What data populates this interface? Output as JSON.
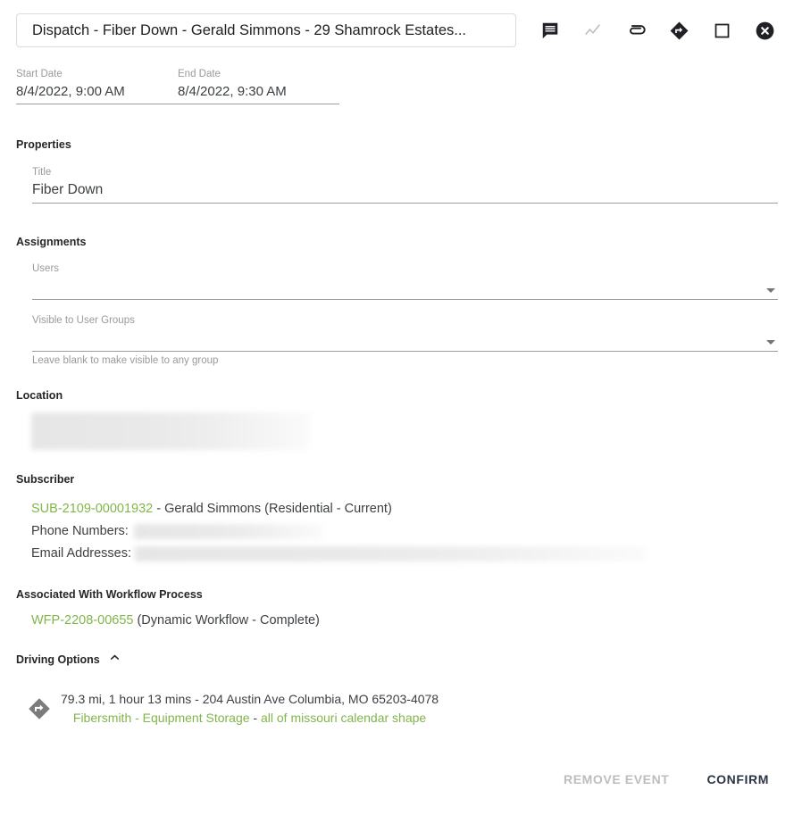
{
  "header": {
    "event_title": "Dispatch - Fiber Down - Gerald Simmons - 29 Shamrock Estates...",
    "actions": [
      {
        "name": "comments-icon",
        "label": "Comments"
      },
      {
        "name": "activity-icon",
        "label": "Activity"
      },
      {
        "name": "attachment-icon",
        "label": "Attachments"
      },
      {
        "name": "directions-icon",
        "label": "Directions"
      },
      {
        "name": "maximize-icon",
        "label": "Maximize"
      },
      {
        "name": "close-icon",
        "label": "Close"
      }
    ]
  },
  "dates": {
    "start_label": "Start Date",
    "start_value": "8/4/2022, 9:00 AM",
    "end_label": "End Date",
    "end_value": "8/4/2022, 9:30 AM"
  },
  "properties": {
    "heading": "Properties",
    "title_label": "Title",
    "title_value": "Fiber Down"
  },
  "assignments": {
    "heading": "Assignments",
    "users_label": "Users",
    "users_value": "",
    "groups_label": "Visible to User Groups",
    "groups_value": "",
    "groups_helper": "Leave blank to make visible to any group"
  },
  "location": {
    "heading": "Location",
    "value_redacted": true
  },
  "subscriber": {
    "heading": "Subscriber",
    "id": "SUB-2109-00001932",
    "detail": " - Gerald Simmons (Residential - Current)",
    "phone_label": "Phone Numbers:",
    "phone_redacted": true,
    "email_label": "Email Addresses:",
    "email_redacted": true
  },
  "workflow": {
    "heading": "Associated With Workflow Process",
    "id": "WFP-2208-00655",
    "detail": " (Dynamic Workflow - Complete)"
  },
  "driving": {
    "heading": "Driving Options",
    "collapse_icon": "chevron-up-icon",
    "route_summary": "79.3 mi, 1 hour 13 mins - 204 Austin Ave Columbia, MO 65203-4078",
    "route_origin": "Fibersmith - Equipment Storage",
    "route_separator": " - ",
    "route_shape": "all of missouri calendar shape"
  },
  "footer": {
    "remove_label": "REMOVE EVENT",
    "confirm_label": "CONFIRM"
  },
  "colors": {
    "link_green": "#82b54b",
    "primary_text": "#2b3445",
    "disabled_text": "#bdbdbd"
  }
}
